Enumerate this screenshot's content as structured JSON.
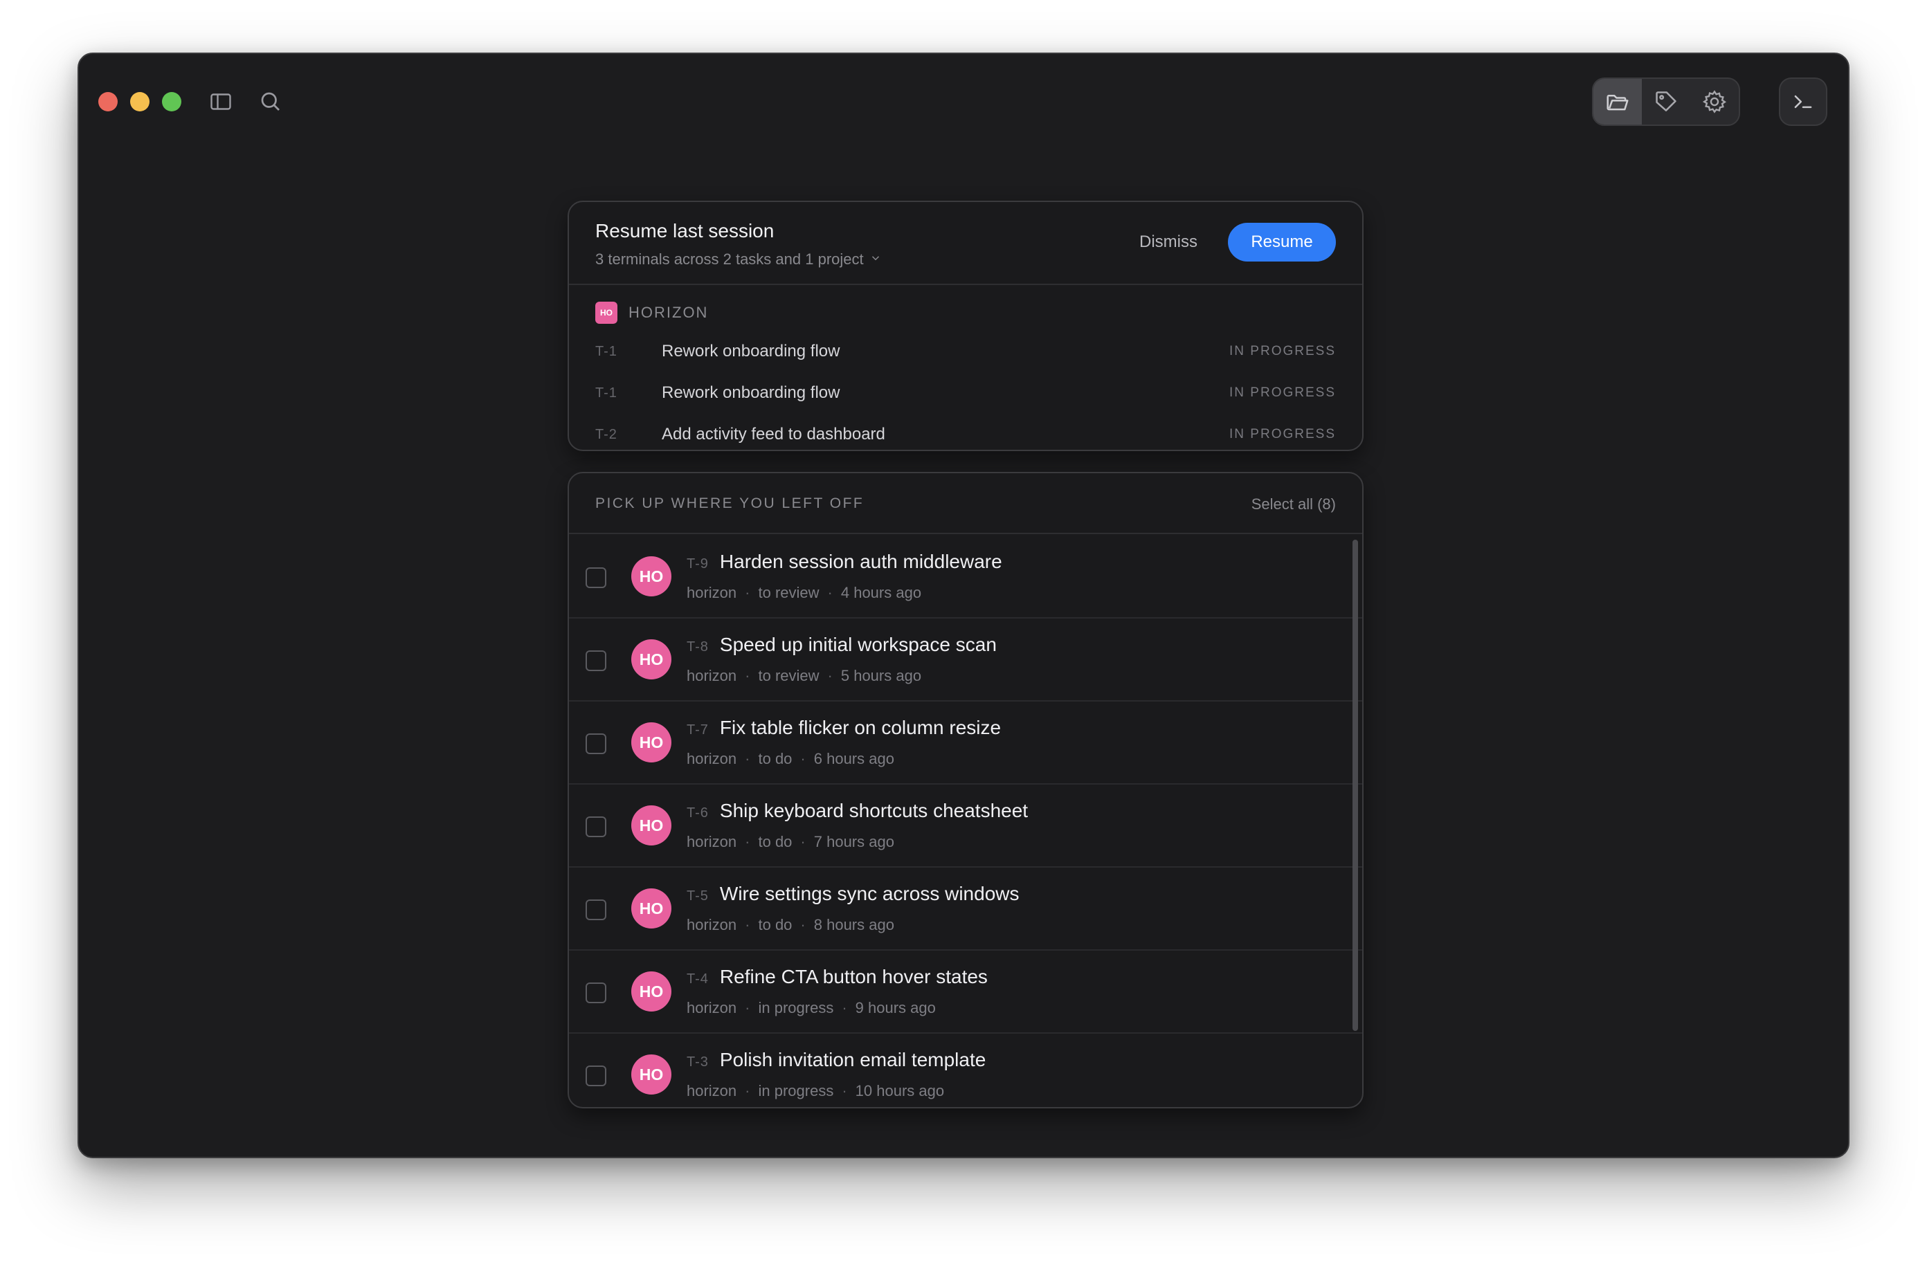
{
  "colors": {
    "window_bg": "#1c1c1e",
    "accent": "#2f7cf6",
    "project_badge": "#e8609e",
    "traffic_red": "#ed6a5e",
    "traffic_yellow": "#f5bf4f",
    "traffic_green": "#61c554"
  },
  "titlebar": {
    "icons": [
      "sidebar-toggle-icon",
      "search-icon",
      "folder-icon",
      "tag-icon",
      "gear-icon",
      "terminal-icon"
    ]
  },
  "resume": {
    "title": "Resume last session",
    "subtitle": "3 terminals across 2 tasks and 1 project",
    "dismiss_label": "Dismiss",
    "resume_label": "Resume",
    "project": {
      "badge": "HO",
      "name": "HORIZON"
    },
    "sessions": [
      {
        "id": "T-1",
        "title": "Rework onboarding flow",
        "status": "IN PROGRESS"
      },
      {
        "id": "T-1",
        "title": "Rework onboarding flow",
        "status": "IN PROGRESS"
      },
      {
        "id": "T-2",
        "title": "Add activity feed to dashboard",
        "status": "IN PROGRESS"
      }
    ]
  },
  "pickup": {
    "title": "PICK UP WHERE YOU LEFT OFF",
    "select_all": "Select all (8)",
    "items": [
      {
        "avatar": "HO",
        "id": "T-9",
        "title": "Harden session auth middleware",
        "project": "horizon",
        "status": "to review",
        "time": "4 hours ago"
      },
      {
        "avatar": "HO",
        "id": "T-8",
        "title": "Speed up initial workspace scan",
        "project": "horizon",
        "status": "to review",
        "time": "5 hours ago"
      },
      {
        "avatar": "HO",
        "id": "T-7",
        "title": "Fix table flicker on column resize",
        "project": "horizon",
        "status": "to do",
        "time": "6 hours ago"
      },
      {
        "avatar": "HO",
        "id": "T-6",
        "title": "Ship keyboard shortcuts cheatsheet",
        "project": "horizon",
        "status": "to do",
        "time": "7 hours ago"
      },
      {
        "avatar": "HO",
        "id": "T-5",
        "title": "Wire settings sync across windows",
        "project": "horizon",
        "status": "to do",
        "time": "8 hours ago"
      },
      {
        "avatar": "HO",
        "id": "T-4",
        "title": "Refine CTA button hover states",
        "project": "horizon",
        "status": "in progress",
        "time": "9 hours ago"
      },
      {
        "avatar": "HO",
        "id": "T-3",
        "title": "Polish invitation email template",
        "project": "horizon",
        "status": "in progress",
        "time": "10 hours ago"
      }
    ]
  }
}
